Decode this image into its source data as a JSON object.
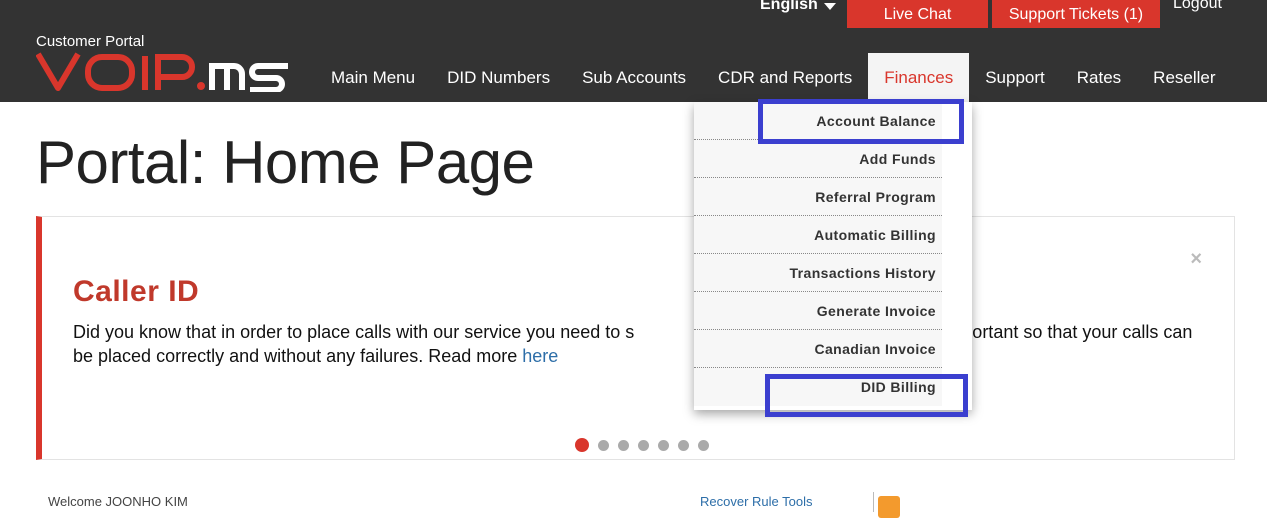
{
  "topbar": {
    "language": "English",
    "live_chat": "Live Chat",
    "support_tickets": "Support Tickets (1)",
    "logout": "Logout"
  },
  "brand": {
    "portal_label": "Customer Portal",
    "logo_text": "VoIP.ms"
  },
  "nav": {
    "items": [
      {
        "label": "Main Menu"
      },
      {
        "label": "DID Numbers"
      },
      {
        "label": "Sub Accounts"
      },
      {
        "label": "CDR and Reports"
      },
      {
        "label": "Finances",
        "active": true
      },
      {
        "label": "Support"
      },
      {
        "label": "Rates"
      },
      {
        "label": "Reseller"
      }
    ]
  },
  "finances_menu": {
    "items": [
      {
        "label": "Account Balance"
      },
      {
        "label": "Add Funds"
      },
      {
        "label": "Referral Program"
      },
      {
        "label": "Automatic Billing"
      },
      {
        "label": "Transactions History"
      },
      {
        "label": "Generate Invoice"
      },
      {
        "label": "Canadian Invoice"
      },
      {
        "label": "DID Billing"
      }
    ]
  },
  "page": {
    "title": "Portal: Home Page"
  },
  "notice": {
    "heading": "Caller ID",
    "text_1": "Did you know that in order to place calls with our service you need to s",
    "text_2": "very important so that your calls can be placed correctly and without any failures. Read more ",
    "link": "here",
    "close": "×",
    "slides": 7,
    "active_slide": 1
  },
  "footer_peek": {
    "welcome": "Welcome JOONHO KIM",
    "right": "Recover Rule Tools"
  },
  "colors": {
    "header_bg": "#333333",
    "accent_red": "#d9362c",
    "highlight_blue": "#3b3fcf",
    "link_blue": "#2d6ea8"
  }
}
